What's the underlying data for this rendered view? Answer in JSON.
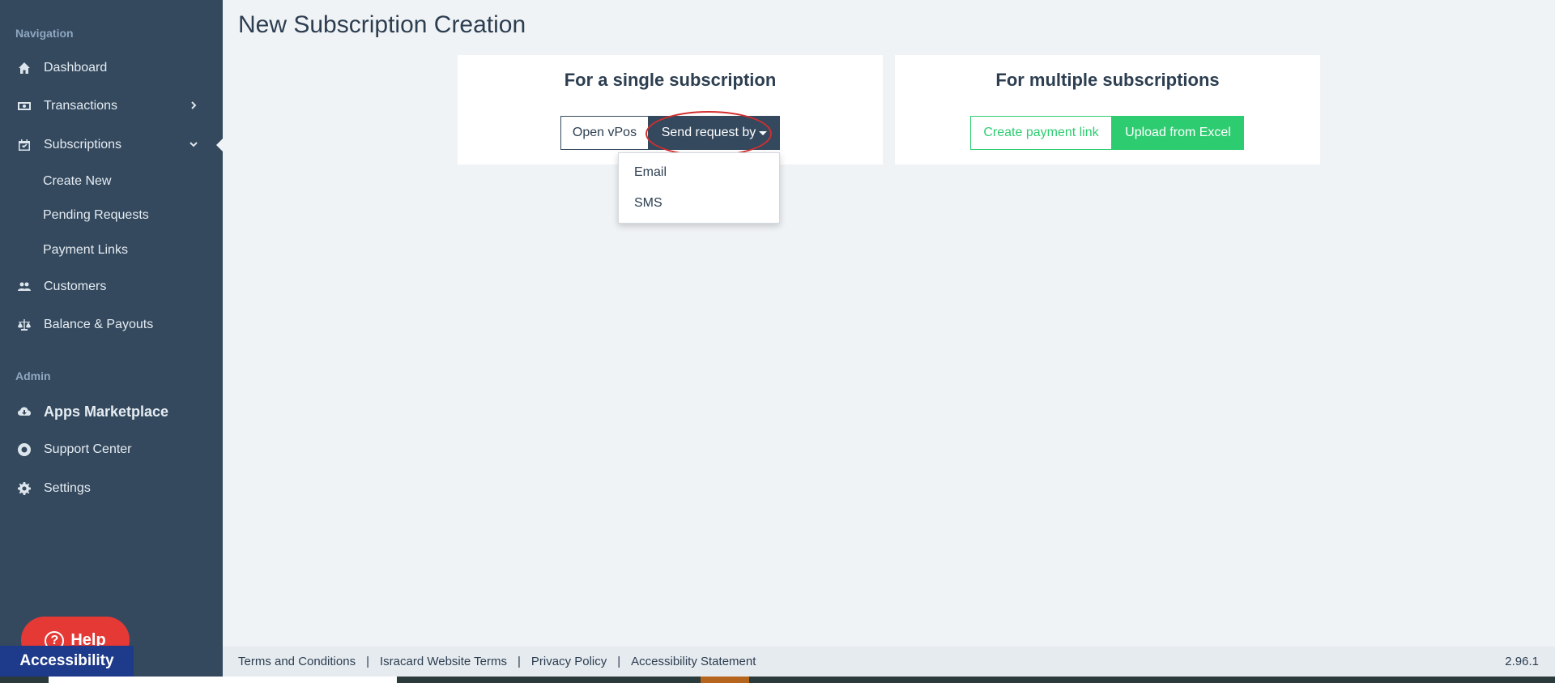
{
  "sidebar": {
    "nav_heading": "Navigation",
    "admin_heading": "Admin",
    "items": {
      "dashboard": "Dashboard",
      "transactions": "Transactions",
      "subscriptions": "Subscriptions",
      "customers": "Customers",
      "balance": "Balance & Payouts",
      "apps": "Apps Marketplace",
      "support": "Support Center",
      "settings": "Settings"
    },
    "subscriptions_sub": {
      "create_new": "Create New",
      "pending": "Pending Requests",
      "payment_links": "Payment Links"
    }
  },
  "page": {
    "title": "New Subscription Creation"
  },
  "single_card": {
    "title": "For a single subscription",
    "open_vpos": "Open vPos",
    "send_request": "Send request by"
  },
  "multi_card": {
    "title": "For multiple subscriptions",
    "create_link": "Create payment link",
    "upload_excel": "Upload from Excel"
  },
  "dropdown": {
    "email": "Email",
    "sms": "SMS"
  },
  "footer": {
    "terms": "Terms and Conditions",
    "isracard": "Isracard Website Terms",
    "privacy": "Privacy Policy",
    "accessibility": "Accessibility Statement",
    "separator": "|",
    "version": "2.96.1"
  },
  "widgets": {
    "help": "Help",
    "help_icon": "?",
    "accessibility": "Accessibility"
  },
  "colors": {
    "sidebar": "#34495e",
    "accent_green": "#2ecc71",
    "highlight_ring": "#d32f2f"
  }
}
